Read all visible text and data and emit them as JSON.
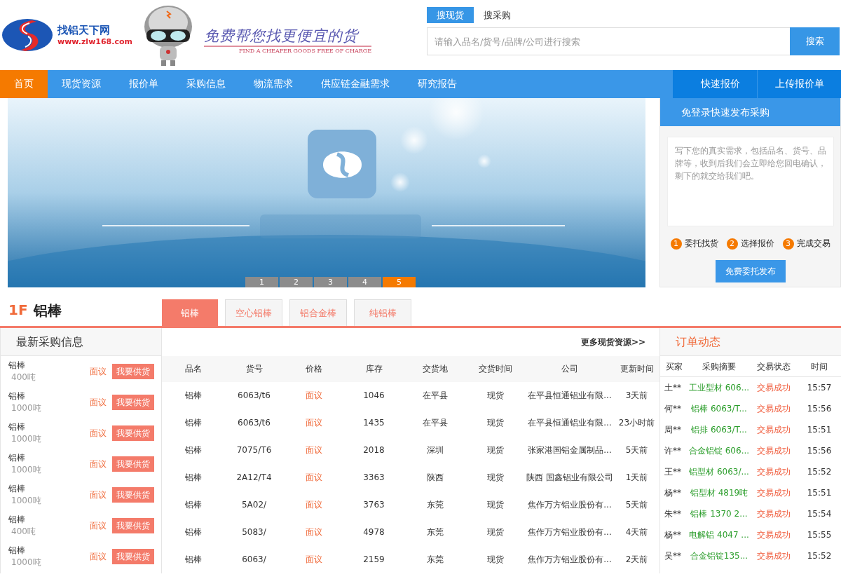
{
  "logo": {
    "name": "找铝天下网",
    "url": "www.zlw168.com"
  },
  "slogan": {
    "text": "免费帮您找更便宜的货",
    "subtitle": "FIND A CHEAPER GOODS FREE OF CHARGE"
  },
  "search": {
    "tabs": [
      {
        "label": "搜现货",
        "selected": true
      },
      {
        "label": "搜采购",
        "selected": false
      }
    ],
    "placeholder": "请输入品名/货号/品牌/公司进行搜索",
    "button": "搜索"
  },
  "nav": {
    "items": [
      {
        "label": "首页",
        "selected": true
      },
      {
        "label": "现货资源",
        "selected": false
      },
      {
        "label": "报价单",
        "selected": false
      },
      {
        "label": "采购信息",
        "selected": false
      },
      {
        "label": "物流需求",
        "selected": false
      },
      {
        "label": "供应链金融需求",
        "selected": false
      },
      {
        "label": "研究报告",
        "selected": false
      }
    ],
    "actions": [
      "快速报价",
      "上传报价单"
    ]
  },
  "banner": {
    "kind": "picture",
    "pages": [
      {
        "label": "1",
        "selected": false
      },
      {
        "label": "2",
        "selected": false
      },
      {
        "label": "3",
        "selected": false
      },
      {
        "label": "4",
        "selected": false
      },
      {
        "label": "5",
        "selected": true
      }
    ]
  },
  "quick_post": {
    "title": "免登录快速发布采购",
    "placeholder": "写下您的真实需求，包括品名、货号、品牌等，收到后我们会立即给您回电确认，剩下的就交给我们吧。",
    "steps": [
      {
        "number": "1",
        "label": "委托找货"
      },
      {
        "number": "2",
        "label": "选择报价"
      },
      {
        "number": "3",
        "label": "完成交易"
      }
    ],
    "button": "免费委托发布"
  },
  "floor": {
    "number": "1F",
    "title": "铝棒",
    "tabs": [
      {
        "label": "铝棒",
        "selected": true
      },
      {
        "label": "空心铝棒",
        "selected": false
      },
      {
        "label": "铝合金棒",
        "selected": false
      },
      {
        "label": "纯铝棒",
        "selected": false
      }
    ]
  },
  "latest_purchases": {
    "title": "最新采购信息",
    "rows": [
      {
        "product": "铝棒",
        "quantity": "400吨",
        "price": "面议",
        "button": "我要供货"
      },
      {
        "product": "铝棒",
        "quantity": "1000吨",
        "price": "面议",
        "button": "我要供货"
      },
      {
        "product": "铝棒",
        "quantity": "1000吨",
        "price": "面议",
        "button": "我要供货"
      },
      {
        "product": "铝棒",
        "quantity": "1000吨",
        "price": "面议",
        "button": "我要供货"
      },
      {
        "product": "铝棒",
        "quantity": "1000吨",
        "price": "面议",
        "button": "我要供货"
      },
      {
        "product": "铝棒",
        "quantity": "400吨",
        "price": "面议",
        "button": "我要供货"
      },
      {
        "product": "铝棒",
        "quantity": "1000吨",
        "price": "面议",
        "button": "我要供货"
      }
    ]
  },
  "spot_table": {
    "more_link": "更多现货资源>>",
    "columns": [
      "品名",
      "货号",
      "价格",
      "库存",
      "交货地",
      "交货时间",
      "公司",
      "更新时间"
    ],
    "rows": [
      [
        "铝棒",
        "6063/t6",
        "面议",
        "1046",
        "在平县",
        "现货",
        "在平县恒通铝业有限...",
        "3天前"
      ],
      [
        "铝棒",
        "6063/t6",
        "面议",
        "1435",
        "在平县",
        "现货",
        "在平县恒通铝业有限...",
        "23小时前"
      ],
      [
        "铝棒",
        "7075/T6",
        "面议",
        "2018",
        "深圳",
        "现货",
        "张家港国铝金属制品...",
        "5天前"
      ],
      [
        "铝棒",
        "2A12/T4",
        "面议",
        "3363",
        "陕西",
        "现货",
        "陕西 国鑫铝业有限公司",
        "1天前"
      ],
      [
        "铝棒",
        "5A02/",
        "面议",
        "3763",
        "东莞",
        "现货",
        "焦作万方铝业股份有...",
        "5天前"
      ],
      [
        "铝棒",
        "5083/",
        "面议",
        "4978",
        "东莞",
        "现货",
        "焦作万方铝业股份有...",
        "4天前"
      ],
      [
        "铝棒",
        "6063/",
        "面议",
        "2159",
        "东莞",
        "现货",
        "焦作万方铝业股份有...",
        "2天前"
      ]
    ]
  },
  "orders": {
    "title": "订单动态",
    "columns": [
      "买家",
      "采购摘要",
      "交易状态",
      "时间"
    ],
    "rows": [
      {
        "buyer": "土**",
        "summary": "工业型材 606...",
        "status": "交易成功",
        "time": "15:57"
      },
      {
        "buyer": "何**",
        "summary": "铝棒 6063/T...",
        "status": "交易成功",
        "time": "15:56"
      },
      {
        "buyer": "周**",
        "summary": "铝排 6063/T...",
        "status": "交易成功",
        "time": "15:51"
      },
      {
        "buyer": "许**",
        "summary": "合金铝锭 606...",
        "status": "交易成功",
        "time": "15:56"
      },
      {
        "buyer": "王**",
        "summary": "铝型材 6063/...",
        "status": "交易成功",
        "time": "15:52"
      },
      {
        "buyer": "杨**",
        "summary": "铝型材 4819吨",
        "status": "交易成功",
        "time": "15:51"
      },
      {
        "buyer": "朱**",
        "summary": "铝棒 1370 2...",
        "status": "交易成功",
        "time": "15:54"
      },
      {
        "buyer": "杨**",
        "summary": "电解铝 4047 ...",
        "status": "交易成功",
        "time": "15:55"
      },
      {
        "buyer": "吴**",
        "summary": "合金铝锭135...",
        "status": "交易成功",
        "time": "15:52"
      }
    ]
  }
}
